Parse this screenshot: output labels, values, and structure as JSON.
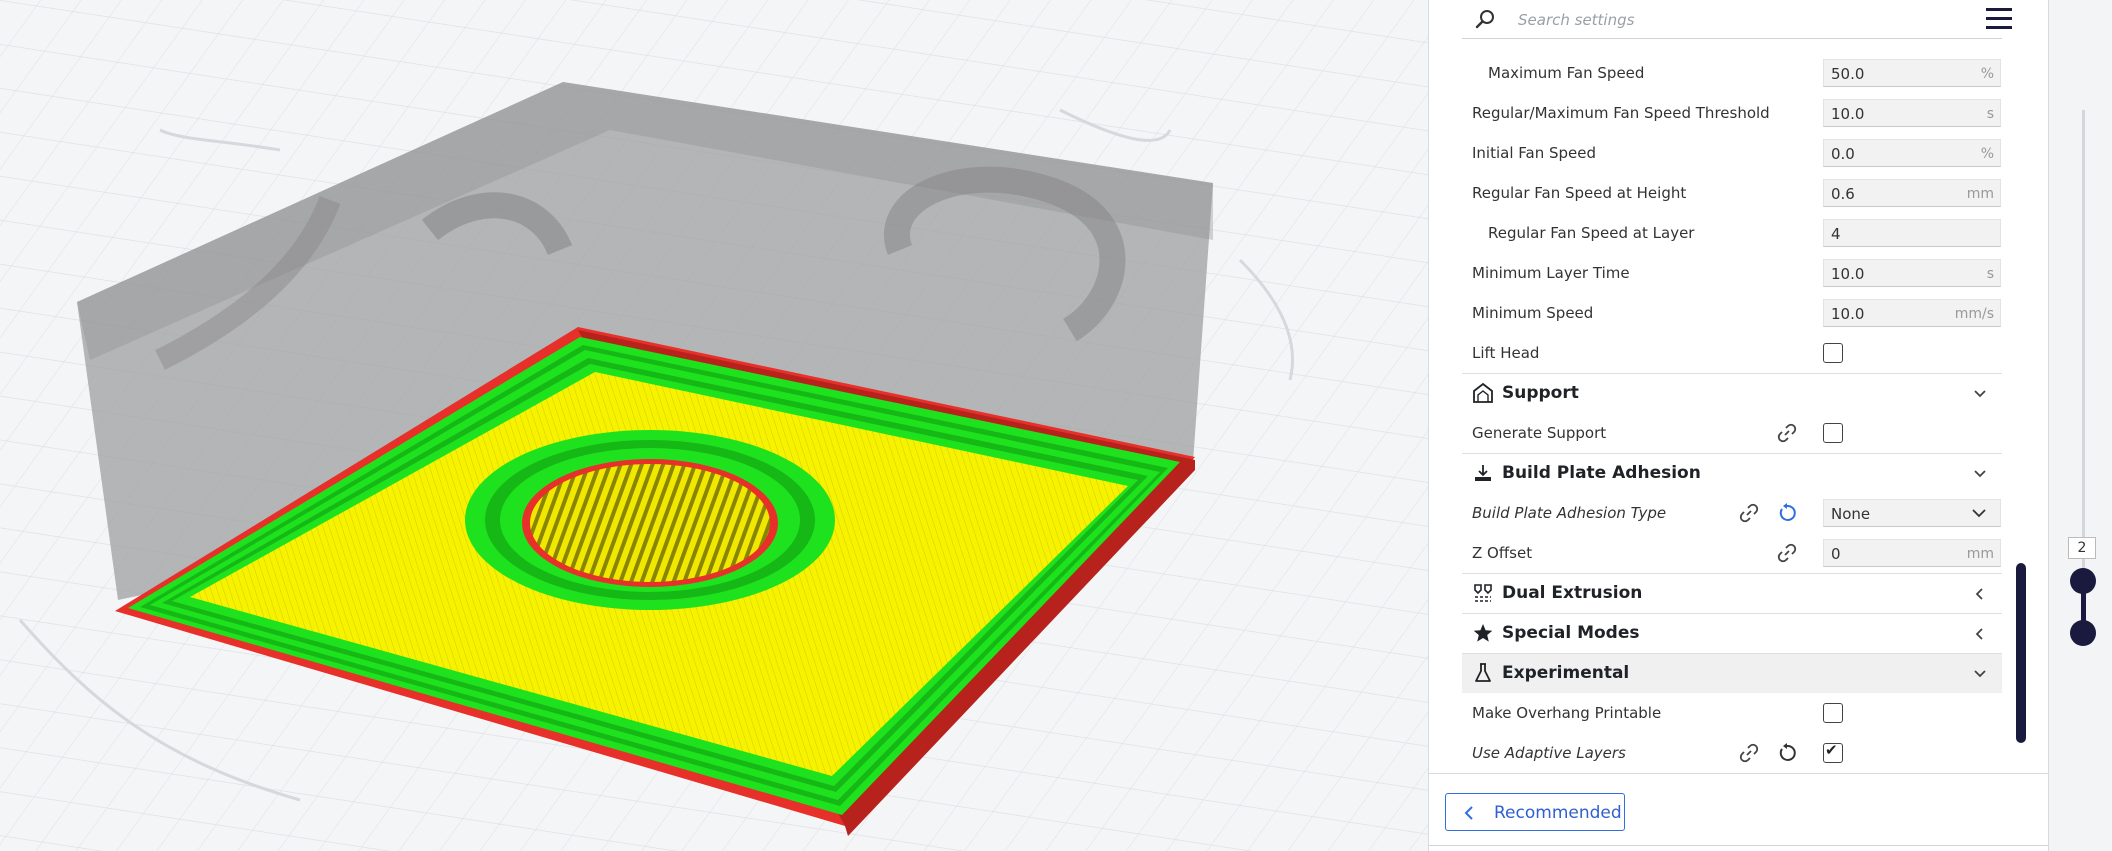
{
  "search": {
    "placeholder": "Search settings"
  },
  "settings": {
    "max_fan_speed": {
      "label": "Maximum Fan Speed",
      "value": "50.0",
      "unit": "%"
    },
    "fan_threshold": {
      "label": "Regular/Maximum Fan Speed Threshold",
      "value": "10.0",
      "unit": "s"
    },
    "initial_fan_speed": {
      "label": "Initial Fan Speed",
      "value": "0.0",
      "unit": "%"
    },
    "fan_at_height": {
      "label": "Regular Fan Speed at Height",
      "value": "0.6",
      "unit": "mm"
    },
    "fan_at_layer": {
      "label": "Regular Fan Speed at Layer",
      "value": "4"
    },
    "min_layer_time": {
      "label": "Minimum Layer Time",
      "value": "10.0",
      "unit": "s"
    },
    "min_speed": {
      "label": "Minimum Speed",
      "value": "10.0",
      "unit": "mm/s"
    },
    "lift_head": {
      "label": "Lift Head",
      "checked": false
    },
    "support_category": "Support",
    "generate_support": {
      "label": "Generate Support",
      "checked": false
    },
    "adhesion_category": "Build Plate Adhesion",
    "adhesion_type": {
      "label": "Build Plate Adhesion Type",
      "value": "None"
    },
    "z_offset": {
      "label": "Z Offset",
      "value": "0",
      "unit": "mm"
    },
    "dual_extrusion_category": "Dual Extrusion",
    "special_modes_category": "Special Modes",
    "experimental_category": "Experimental",
    "overhang": {
      "label": "Make Overhang Printable",
      "checked": false
    },
    "adaptive_layers": {
      "label": "Use Adaptive Layers",
      "checked": true,
      "tick": "✔"
    }
  },
  "footer": {
    "recommended_label": "Recommended"
  },
  "layer_slider": {
    "current_layer": "2"
  },
  "colors": {
    "accent": "#2f6fe0",
    "dark": "#1a1a3f",
    "wall_outer": "#e8302a",
    "wall_inner": "#1fe21f",
    "skin": "#f5f200"
  }
}
